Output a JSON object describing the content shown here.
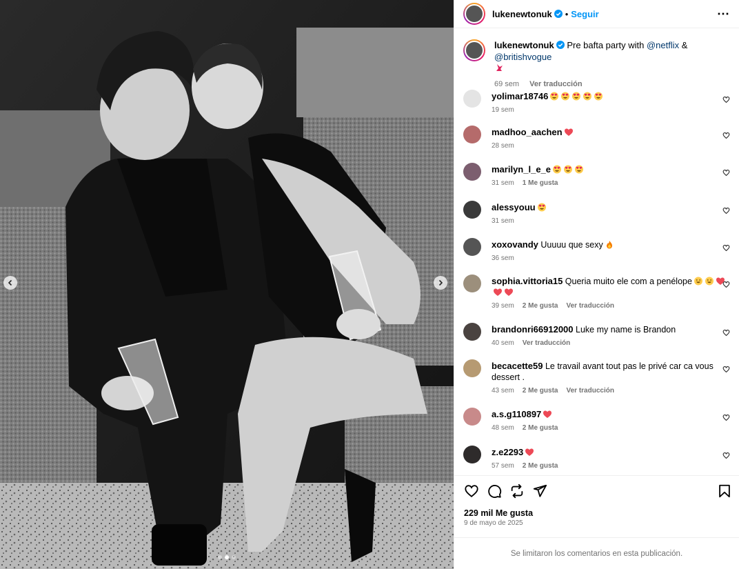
{
  "post": {
    "username": "lukenewtonuk",
    "follow_label": "Seguir",
    "separator": "•",
    "caption_text": "Pre bafta party with",
    "caption_mention_1": "@netflix",
    "caption_amp": "&",
    "caption_mention_2": "@britishvogue",
    "caption_age": "69 sem",
    "caption_translate": "Ver traducción",
    "likes": "229 mil Me gusta",
    "date": "9 de mayo de 2025",
    "comments_limited": "Se limitaron los comentarios en esta publicación.",
    "carousel": {
      "slide_count": 3,
      "active_slide": 2
    }
  },
  "comments": [
    {
      "user": "yolimar18746",
      "text": "",
      "emoji": [
        "face",
        "face",
        "face",
        "face",
        "face"
      ],
      "age": "19 sem",
      "likes": "",
      "translate": ""
    },
    {
      "user": "madhoo_aachen",
      "text": "",
      "emoji": [
        "heart"
      ],
      "age": "28 sem",
      "likes": "",
      "translate": ""
    },
    {
      "user": "marilyn_l_e_e",
      "text": "",
      "emoji": [
        "face",
        "face",
        "face"
      ],
      "age": "31 sem",
      "likes": "1 Me gusta",
      "translate": ""
    },
    {
      "user": "alessyouu",
      "text": "",
      "emoji": [
        "face"
      ],
      "age": "31 sem",
      "likes": "",
      "translate": ""
    },
    {
      "user": "xoxovandy",
      "text": "Uuuuu que sexy",
      "emoji": [
        "fire"
      ],
      "age": "36 sem",
      "likes": "",
      "translate": ""
    },
    {
      "user": "sophia.vittoria15",
      "text": "Queria muito ele com a penélope",
      "emoji": [
        "grin",
        "grin",
        "heart",
        "heart",
        "heart"
      ],
      "age": "39 sem",
      "likes": "2 Me gusta",
      "translate": "Ver traducción"
    },
    {
      "user": "brandonri66912000",
      "text": "Luke my name is Brandon",
      "emoji": [],
      "age": "40 sem",
      "likes": "",
      "translate": "Ver traducción"
    },
    {
      "user": "becacette59",
      "text": "Le travail avant tout pas le privé car ca vous dessert .",
      "emoji": [],
      "age": "43 sem",
      "likes": "2 Me gusta",
      "translate": "Ver traducción"
    },
    {
      "user": "a.s.g110897",
      "text": "",
      "emoji": [
        "heart"
      ],
      "age": "48 sem",
      "likes": "2 Me gusta",
      "translate": ""
    },
    {
      "user": "z.e2293",
      "text": "",
      "emoji": [
        "heart"
      ],
      "age": "57 sem",
      "likes": "2 Me gusta",
      "translate": ""
    }
  ],
  "colors": {
    "link": "#0095f6",
    "mention": "#00376b",
    "muted": "#737373",
    "heart": "#ed4956",
    "divider": "#efefef"
  },
  "icons": [
    "verified-icon",
    "more-options-icon",
    "heart-icon",
    "comment-icon",
    "repost-icon",
    "share-icon",
    "bookmark-icon",
    "chevron-left-icon",
    "chevron-right-icon"
  ]
}
